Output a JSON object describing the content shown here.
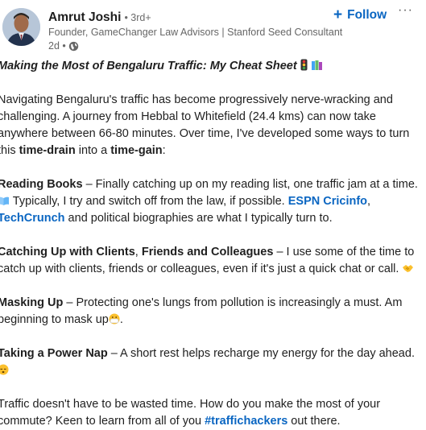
{
  "author": {
    "name": "Amrut Joshi",
    "degree": "• 3rd+",
    "headline": "Founder, GameChanger Law Advisors | Stanford Seed Consultant",
    "time": "2d •",
    "visibility_icon": "globe-icon"
  },
  "actions": {
    "follow_label": "Follow",
    "more_label": "···"
  },
  "post": {
    "title": "Making the Most of Bengaluru Traffic: My Cheat Sheet",
    "intro_1": "Navigating Bengaluru's traffic has become progressively nerve-wracking and challenging. A journey from Hebbal to Whitefield (24.4 kms) can now take anywhere between 66-80 minutes. Over time, I've developed some ways to turn this ",
    "intro_bold_1": "time-drain",
    "intro_mid": " into a ",
    "intro_bold_2": "time-gain",
    "intro_end": ":",
    "item1_head": "Reading Books",
    "item1_text": " – Finally catching up on my reading list, one traffic jam at a time. ",
    "item1_text2": " Typically, I try and switch off from the law, if possible. ",
    "item1_link1": "ESPN Cricinfo",
    "item1_sep": ", ",
    "item1_link2": "TechCrunch",
    "item1_text3": " and political biographies are what I typically turn to.",
    "item2_head_a": "Catching Up with Clients",
    "item2_head_sep": ", ",
    "item2_head_b": "Friends and Colleagues",
    "item2_text": " – I use some of the time to catch up with clients, friends or colleagues, even if it's just a quick chat or call. ",
    "item3_head": "Masking Up",
    "item3_text": " – Protecting one's lungs from pollution is increasingly a must. Am beginning to mask up",
    "item3_end": ".",
    "item4_head": "Taking a Power Nap",
    "item4_text": " – A short rest helps recharge my energy for the day ahead. ",
    "closing": "Traffic doesn't have to be wasted time. How do you make the most of your commute? Keen to learn from all of you ",
    "hashtag": "#traffichackers",
    "closing_end": " out there."
  },
  "colors": {
    "link": "#0a66c2",
    "text": "#1f1f1f",
    "muted": "#666666"
  }
}
